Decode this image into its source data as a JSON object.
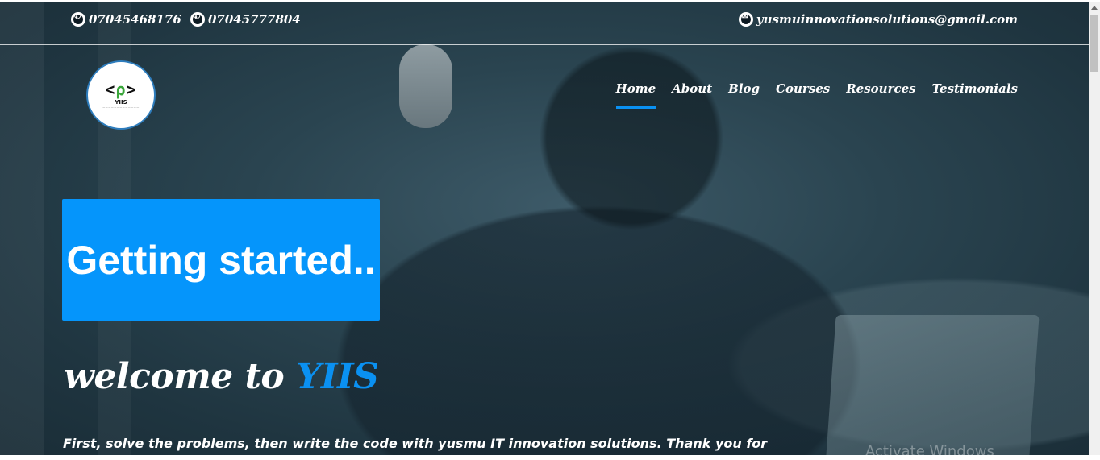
{
  "contacts": {
    "phone1": "07045468176",
    "phone2": "07045777804",
    "email": "yusmuinnovationsolutions@gmail.com"
  },
  "logo": {
    "mark_left": "<",
    "mark_mid": "ρ",
    "mark_right": ">",
    "text": "YIIS"
  },
  "nav": {
    "items": [
      "Home",
      "About",
      "Blog",
      "Courses",
      "Resources",
      "Testimonials"
    ],
    "active": "Home"
  },
  "hero": {
    "headline": "Getting started..",
    "welcome_prefix": "welcome to",
    "welcome_brand": "YIIS",
    "tagline": "First, solve the problems, then write the code with yusmu IT innovation solutions. Thank you for"
  },
  "system": {
    "watermark": "Activate Windows"
  },
  "colors": {
    "accent": "#0595fb",
    "overlay": "#2a4450"
  }
}
